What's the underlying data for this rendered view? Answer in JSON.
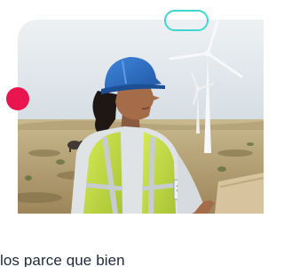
{
  "photo": {
    "subject": "worker-in-hard-hat-at-wind-farm"
  },
  "caption": {
    "text": "los parce que bien"
  },
  "colors": {
    "accent_dot": "#e8154e",
    "accent_pill": "#3fd6d0",
    "sky": "#dfe6ec",
    "field": "#b9a67a",
    "helmet": "#2e73c8",
    "vest": "#c9e14a",
    "caption_text": "#1f2937"
  }
}
